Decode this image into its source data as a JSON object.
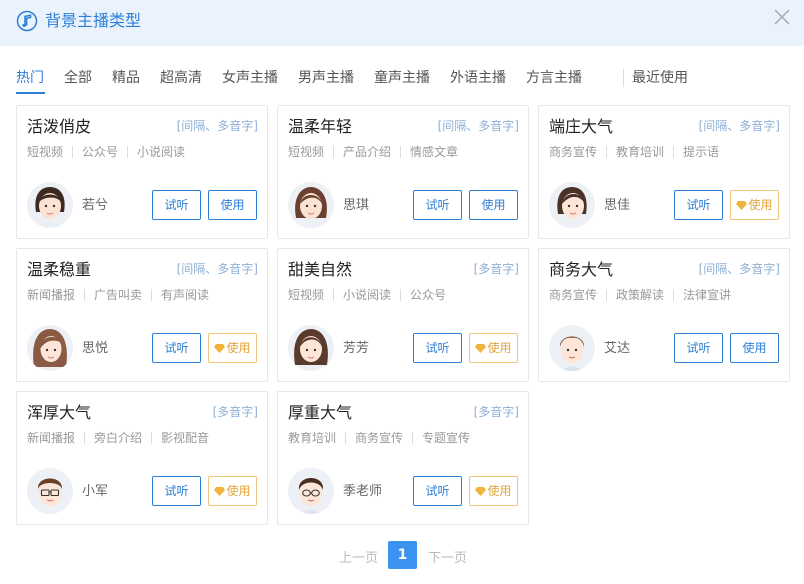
{
  "header": {
    "title": "背景主播类型",
    "title_icon": "music-note-icon",
    "close_icon": "close-icon"
  },
  "tabs": [
    {
      "label": "热门",
      "active": true
    },
    {
      "label": "全部",
      "active": false
    },
    {
      "label": "精品",
      "active": false
    },
    {
      "label": "超高清",
      "active": false
    },
    {
      "label": "女声主播",
      "active": false
    },
    {
      "label": "男声主播",
      "active": false
    },
    {
      "label": "童声主播",
      "active": false
    },
    {
      "label": "外语主播",
      "active": false
    },
    {
      "label": "方言主播",
      "active": false
    },
    {
      "label": "最近使用",
      "active": false
    }
  ],
  "cards": [
    {
      "title": "活泼俏皮",
      "feature": "[间隔、多音字]",
      "scenes": [
        "短视频",
        "公众号",
        "小说阅读"
      ],
      "anchor": "若兮",
      "listen": "试听",
      "use": "使用",
      "vip": false
    },
    {
      "title": "温柔年轻",
      "feature": "[间隔、多音字]",
      "scenes": [
        "短视频",
        "产品介绍",
        "情感文章"
      ],
      "anchor": "思琪",
      "listen": "试听",
      "use": "使用",
      "vip": false
    },
    {
      "title": "端庄大气",
      "feature": "[间隔、多音字]",
      "scenes": [
        "商务宣传",
        "教育培训",
        "提示语"
      ],
      "anchor": "思佳",
      "listen": "试听",
      "use": "使用",
      "vip": true
    },
    {
      "title": "温柔稳重",
      "feature": "[间隔、多音字]",
      "scenes": [
        "新闻播报",
        "广告叫卖",
        "有声阅读"
      ],
      "anchor": "思悦",
      "listen": "试听",
      "use": "使用",
      "vip": true
    },
    {
      "title": "甜美自然",
      "feature": "[多音字]",
      "scenes": [
        "短视频",
        "小说阅读",
        "公众号"
      ],
      "anchor": "芳芳",
      "listen": "试听",
      "use": "使用",
      "vip": true
    },
    {
      "title": "商务大气",
      "feature": "[间隔、多音字]",
      "scenes": [
        "商务宣传",
        "政策解读",
        "法律宣讲"
      ],
      "anchor": "艾达",
      "listen": "试听",
      "use": "使用",
      "vip": false
    },
    {
      "title": "浑厚大气",
      "feature": "[多音字]",
      "scenes": [
        "新闻播报",
        "旁白介绍",
        "影视配音"
      ],
      "anchor": "小军",
      "listen": "试听",
      "use": "使用",
      "vip": true
    },
    {
      "title": "厚重大气",
      "feature": "[多音字]",
      "scenes": [
        "教育培训",
        "商务宣传",
        "专题宣传"
      ],
      "anchor": "季老师",
      "listen": "试听",
      "use": "使用",
      "vip": true
    }
  ],
  "pagination": {
    "prev": "上一页",
    "current": "1",
    "next": "下一页"
  },
  "colors": {
    "accent": "#2d7fd6",
    "header_bg": "#eaf3fc",
    "vip": "#e0a43a",
    "page_active": "#3a93ee"
  }
}
